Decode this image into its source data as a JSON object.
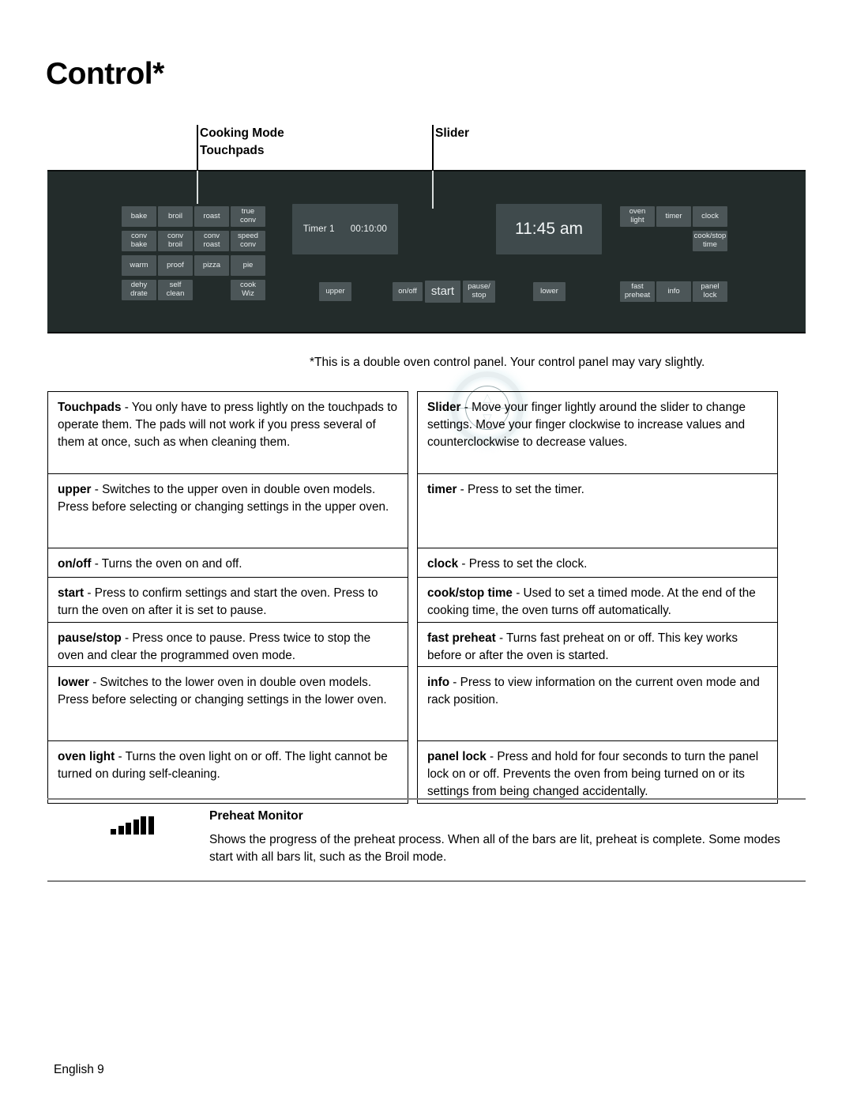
{
  "page": {
    "title": "Control*",
    "footer": "English 9",
    "figure_caption": "*This is a double oven control panel. Your control panel may vary slightly."
  },
  "callouts": {
    "cooking_mode": "Cooking Mode\nTouchpads",
    "slider": "Slider"
  },
  "control_panel": {
    "background_color": "#232c2b",
    "pad_color": "#4c5658",
    "display_color": "#3f4a4c",
    "mode_pads": [
      "bake",
      "broil",
      "roast",
      "true\nconv",
      "conv\nbake",
      "conv\nbroil",
      "conv\nroast",
      "speed\nconv",
      "warm",
      "proof",
      "pizza",
      "pie",
      "dehy\ndrate",
      "self\nclean",
      "",
      "cook\nWiz"
    ],
    "timer_display": {
      "label": "Timer 1",
      "value": "00:10:00"
    },
    "clock_display": "11:45 am",
    "slider": {
      "up_icon": "chevron-up-icon",
      "down_icon": "chevron-down-icon"
    },
    "control_pads": [
      "upper",
      "on/off",
      "start",
      "pause/\nstop",
      "lower"
    ],
    "right_pads": [
      "oven\nlight",
      "timer",
      "clock",
      "cook/stop\ntime",
      "fast\npreheat",
      "info",
      "panel\nlock"
    ]
  },
  "descriptions": {
    "left": [
      {
        "term": "Touchpads",
        "text": " - You only have to press lightly on the touchpads to operate them. The pads will not work if you press several of them at once, such as when cleaning them."
      },
      {
        "term": "upper",
        "text": " - Switches to the upper oven in double oven models. Press before selecting or changing settings in the upper oven."
      },
      {
        "term": "on/off",
        "text": " - Turns the oven on and off."
      },
      {
        "term": "start",
        "text": " - Press to confirm settings and start the oven. Press to turn the oven on after it is set to pause."
      },
      {
        "term": "pause/stop",
        "text": " - Press once to pause. Press twice to stop the oven and clear the programmed oven mode."
      },
      {
        "term": "lower",
        "text": " - Switches to the lower oven in double oven models. Press before selecting or changing settings in the lower oven."
      },
      {
        "term": "oven light",
        "text": " - Turns the oven light on or off. The light cannot be turned on during self-cleaning."
      }
    ],
    "right": [
      {
        "term": "Slider",
        "text": " - Move your finger lightly around the slider to change settings. Move your finger clockwise to increase values and counterclockwise to decrease values."
      },
      {
        "term": "timer",
        "text": " - Press to set the timer."
      },
      {
        "term": "clock",
        "text": " - Press to set the clock."
      },
      {
        "term": "cook/stop time",
        "text": " - Used to set a timed mode. At the end of the cooking time, the oven turns off automatically."
      },
      {
        "term": "fast preheat",
        "text": " - Turns fast preheat on or off. This key works before or after the oven is started."
      },
      {
        "term": "info",
        "text": " - Press to view information on the current oven mode and rack position."
      },
      {
        "term": "panel lock",
        "text": " - Press and hold for four seconds to turn the panel lock on or off. Prevents the oven from being turned on or its settings from being changed accidentally."
      }
    ]
  },
  "preheat_monitor": {
    "icon": "preheat-bars-icon",
    "title": "Preheat Monitor",
    "description": "Shows the progress of the preheat process. When all of the bars are lit, preheat is complete. Some modes start with all bars lit, such as the Broil mode."
  }
}
